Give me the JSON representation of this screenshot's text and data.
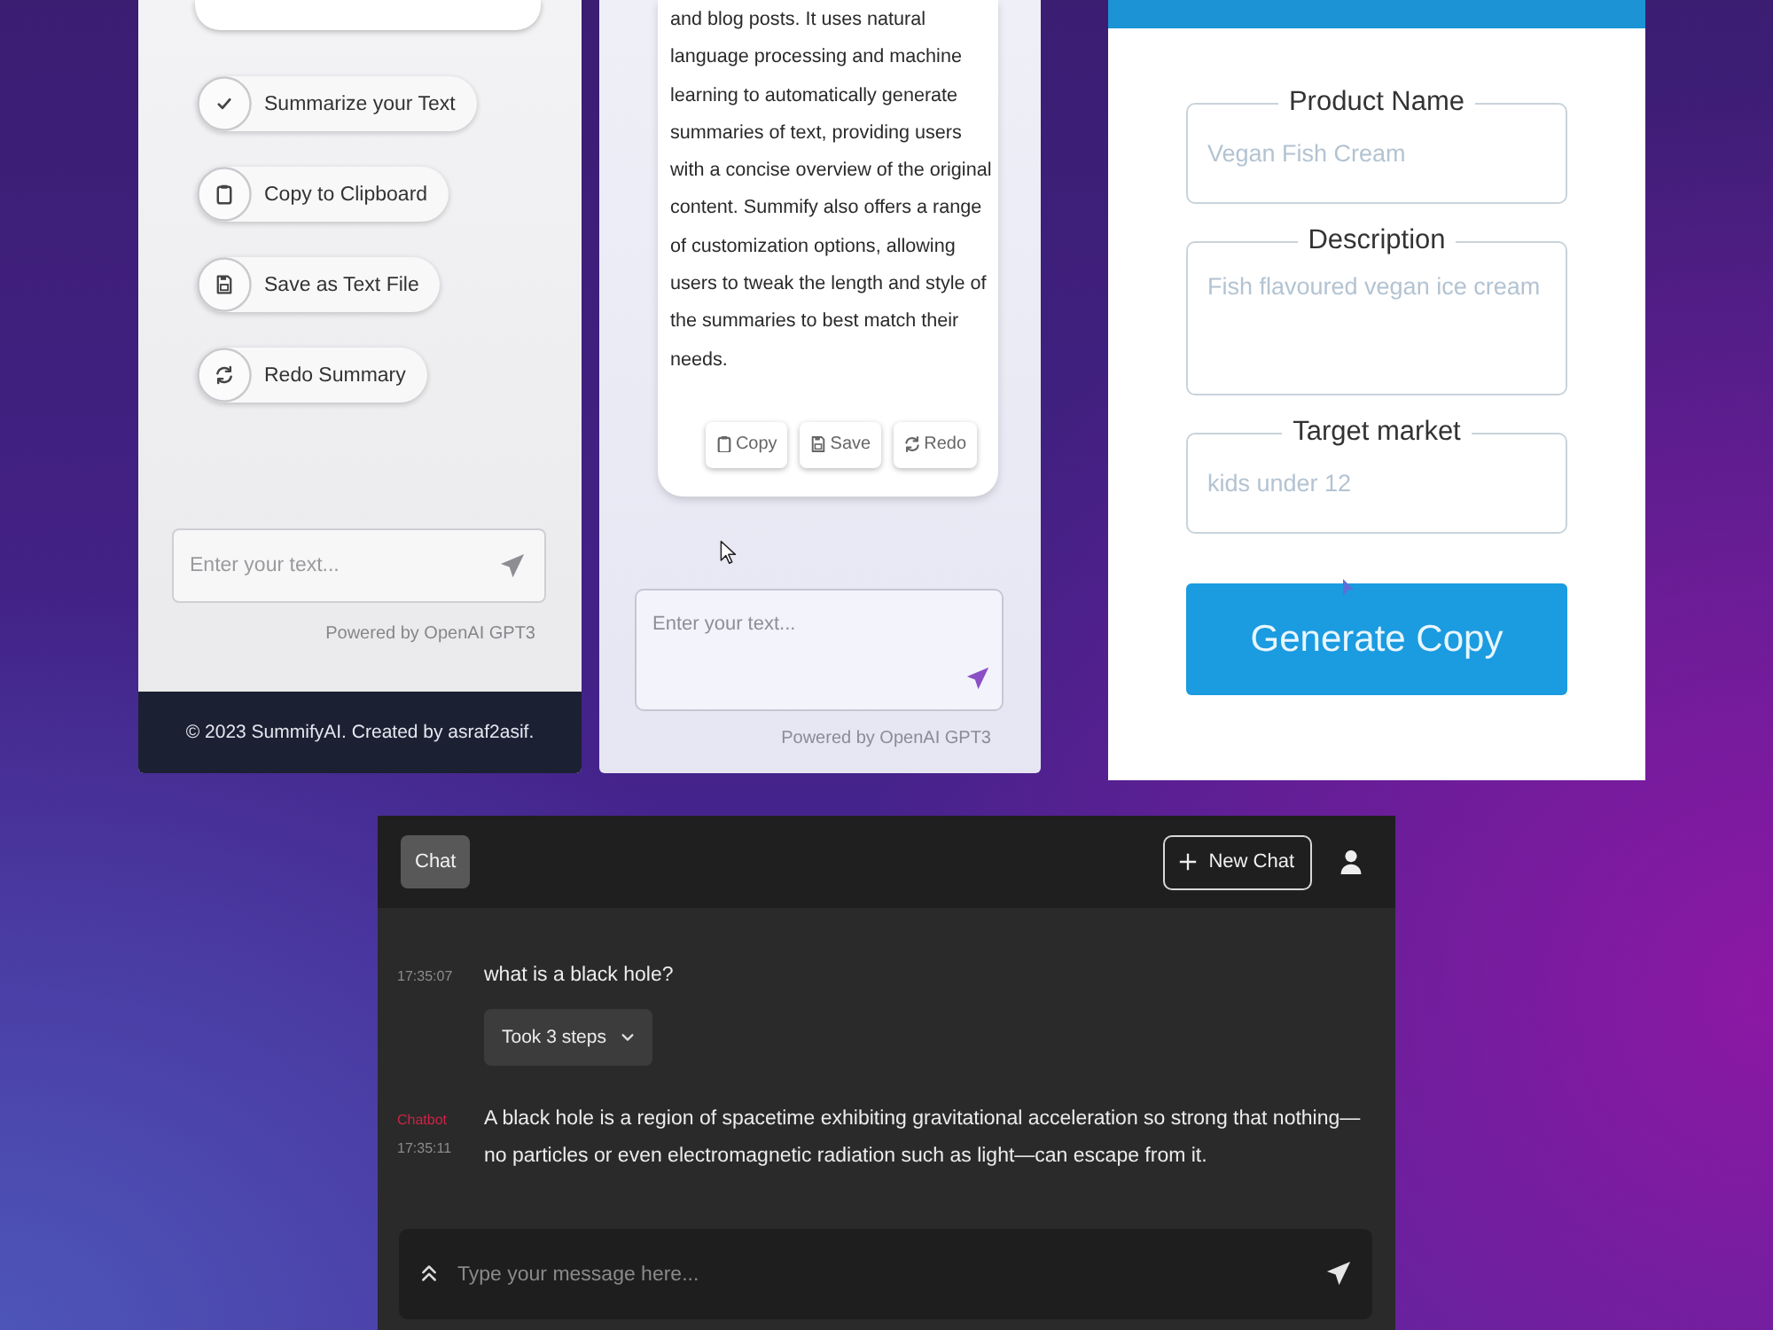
{
  "summify_panel": {
    "actions": [
      {
        "label": "Summarize your Text",
        "kind": "check"
      },
      {
        "label": "Copy to Clipboard",
        "kind": "clipboard"
      },
      {
        "label": "Save as Text File",
        "kind": "save"
      },
      {
        "label": "Redo Summary",
        "kind": "redo"
      }
    ],
    "input": {
      "placeholder": "Enter your text..."
    },
    "powered_by": "Powered by OpenAI GPT3",
    "footer": "© 2023 SummifyAI. Created by asraf2asif."
  },
  "summary_panel": {
    "summary": "and blog posts. It uses natural language processing and machine learning to automatically generate summaries of text, providing users with a concise overview of the original content. Summify also offers a range of customization options, allowing users to tweak the length and style of the summaries to best match their needs.",
    "buttons": [
      {
        "label": "Copy",
        "kind": "clipboard"
      },
      {
        "label": "Save",
        "kind": "save"
      },
      {
        "label": "Redo",
        "kind": "redo"
      }
    ],
    "input": {
      "placeholder": "Enter your text..."
    },
    "powered_by": "Powered by OpenAI GPT3"
  },
  "copy_generator": {
    "fields": [
      {
        "label": "Product Name",
        "placeholder": "Vegan Fish Cream",
        "kind": "single_line"
      },
      {
        "label": "Description",
        "placeholder": "Fish flavoured vegan ice cream",
        "kind": "multi_line"
      },
      {
        "label": "Target market",
        "placeholder": "kids under 12",
        "kind": "single_line"
      }
    ],
    "button": "Generate Copy"
  },
  "chat": {
    "header": {
      "chat_button": "Chat",
      "new_chat_button": "New Chat"
    },
    "messages": [
      {
        "kind": "user",
        "time": "17:35:07",
        "text": "what is a black hole?",
        "steps_button": "Took 3 steps"
      },
      {
        "kind": "bot",
        "sender": "Chatbot",
        "time": "17:35:11",
        "text": "A black hole is a region of spacetime exhibiting gravitational acceleration so strong that nothing—no particles or even electromagnetic radiation such as light—can escape from it."
      }
    ],
    "input": {
      "placeholder": "Type your message here..."
    }
  }
}
